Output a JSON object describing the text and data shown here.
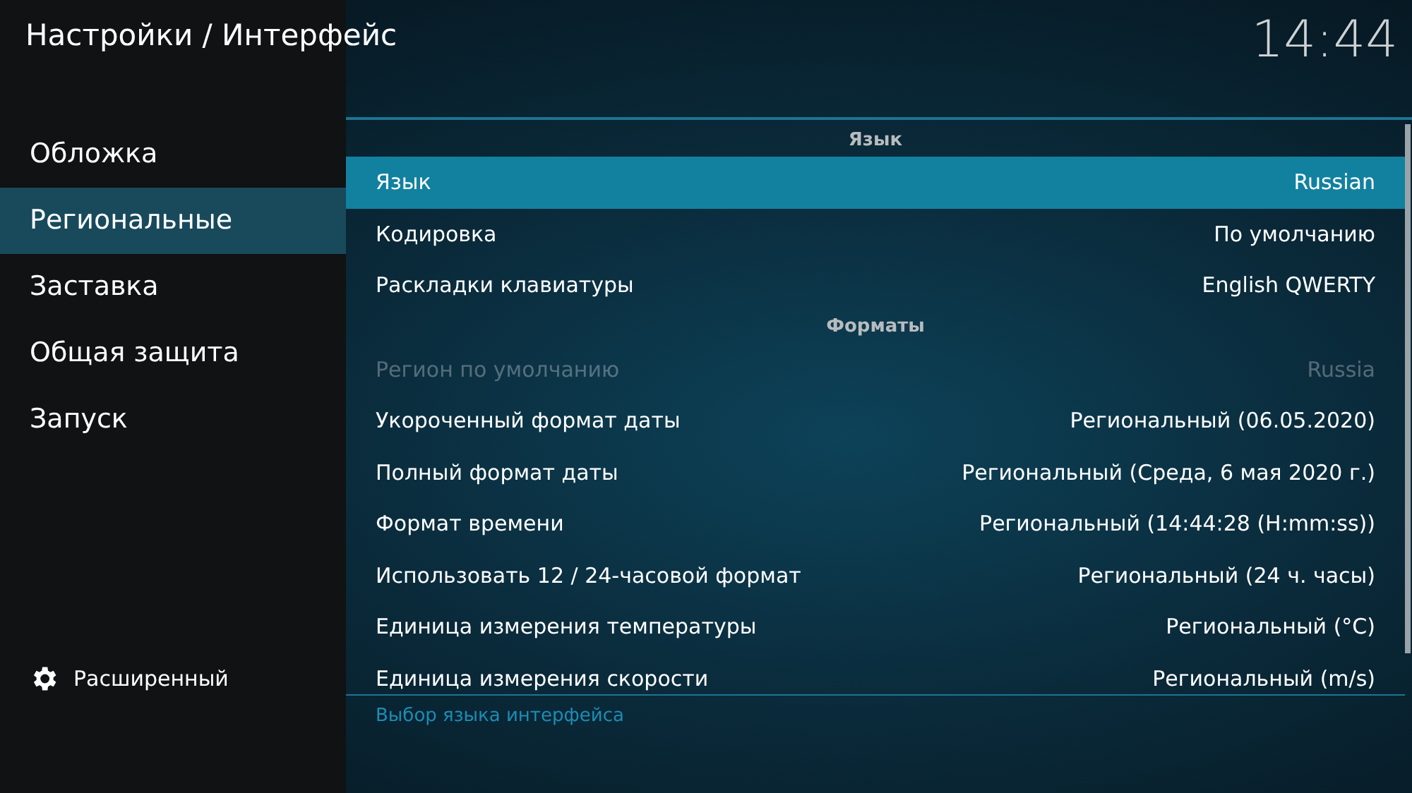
{
  "window": {
    "title": "Настройки / Интерфейс"
  },
  "clock": "14:44",
  "sidebar": {
    "items": [
      {
        "label": "Обложка",
        "selected": false
      },
      {
        "label": "Региональные",
        "selected": true
      },
      {
        "label": "Заставка",
        "selected": false
      },
      {
        "label": "Общая защита",
        "selected": false
      },
      {
        "label": "Запуск",
        "selected": false
      }
    ],
    "level_button": {
      "label": "Расширенный"
    }
  },
  "settings": [
    {
      "kind": "header",
      "label": "Язык"
    },
    {
      "kind": "setting",
      "label": "Язык",
      "value": "Russian",
      "selected": true,
      "disabled": false
    },
    {
      "kind": "setting",
      "label": "Кодировка",
      "value": "По умолчанию",
      "selected": false,
      "disabled": false
    },
    {
      "kind": "setting",
      "label": "Раскладки клавиатуры",
      "value": "English QWERTY",
      "selected": false,
      "disabled": false
    },
    {
      "kind": "header",
      "label": "Форматы"
    },
    {
      "kind": "setting",
      "label": "Регион по умолчанию",
      "value": "Russia",
      "selected": false,
      "disabled": true
    },
    {
      "kind": "setting",
      "label": "Укороченный формат даты",
      "value": "Региональный (06.05.2020)",
      "selected": false,
      "disabled": false
    },
    {
      "kind": "setting",
      "label": "Полный формат даты",
      "value": "Региональный (Среда, 6 мая 2020 г.)",
      "selected": false,
      "disabled": false
    },
    {
      "kind": "setting",
      "label": "Формат времени",
      "value": "Региональный (14:44:28 (H:mm:ss))",
      "selected": false,
      "disabled": false
    },
    {
      "kind": "setting",
      "label": "Использовать 12 / 24-часовой формат",
      "value": "Региональный (24 ч. часы)",
      "selected": false,
      "disabled": false
    },
    {
      "kind": "setting",
      "label": "Единица измерения температуры",
      "value": "Региональный (°C)",
      "selected": false,
      "disabled": false
    },
    {
      "kind": "setting",
      "label": "Единица измерения скорости",
      "value": "Региональный (m/s)",
      "selected": false,
      "disabled": false
    }
  ],
  "description": "Выбор языка интерфейса"
}
